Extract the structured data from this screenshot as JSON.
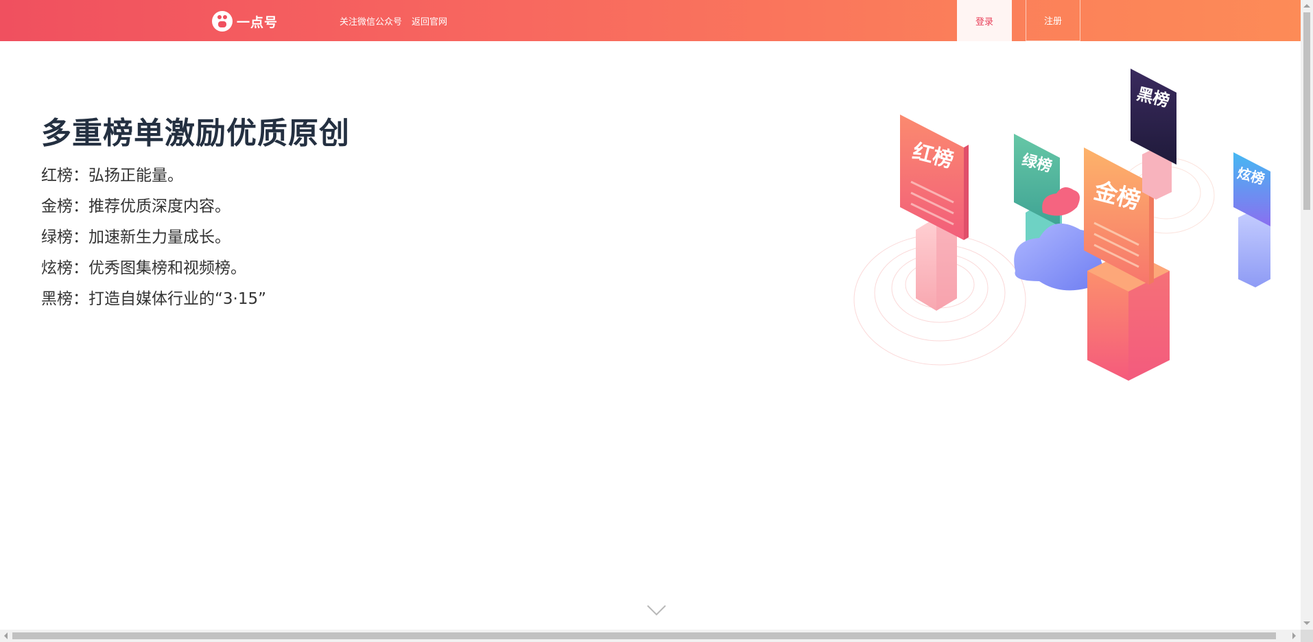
{
  "header": {
    "logo_text": "一点号",
    "nav": [
      "关注微信公众号",
      "返回官网"
    ],
    "login_label": "登录",
    "register_label": "注册"
  },
  "hero": {
    "title": "多重榜单激励优质原创",
    "items": [
      "红榜：弘扬正能量。",
      "金榜：推荐优质深度内容。",
      "绿榜：加速新生力量成长。",
      "炫榜：优秀图集榜和视频榜。",
      "黑榜：打造自媒体行业的“3·15”"
    ]
  },
  "illustration": {
    "boards": [
      "红榜",
      "绿榜",
      "金榜",
      "黑榜",
      "炫榜"
    ]
  },
  "colors": {
    "header_start": "#f0505f",
    "header_end": "#fd8b57",
    "login_text": "#e8405a",
    "title_text": "#243041"
  }
}
